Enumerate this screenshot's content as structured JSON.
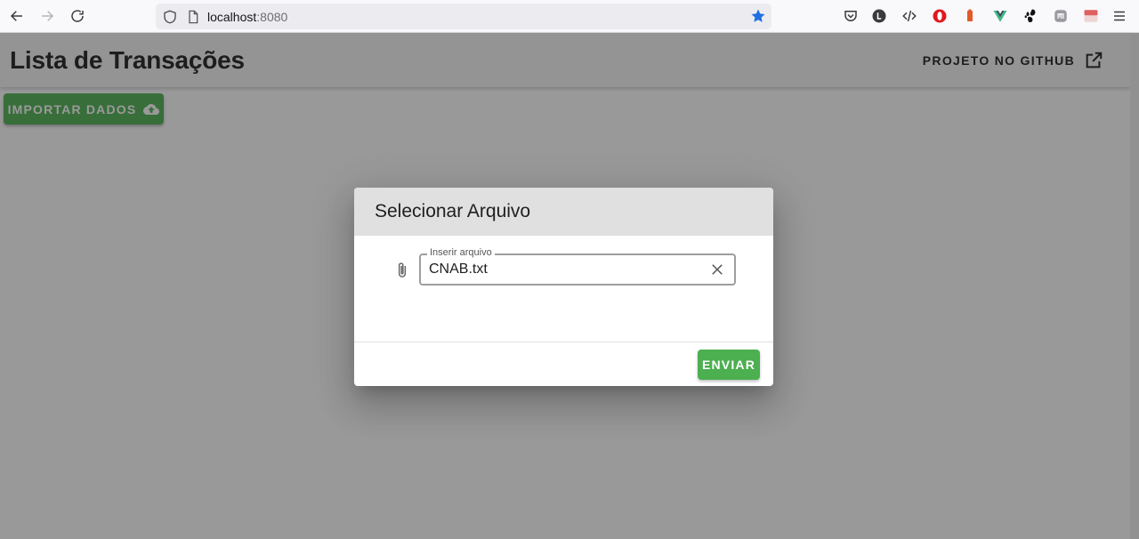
{
  "browser": {
    "url_host": "localhost",
    "url_port": ":8080",
    "extensions": [
      "pocket-icon",
      "l-extension-icon",
      "dev-tools-icon",
      "opera-icon",
      "battery-extension-icon",
      "vue-devtools-icon",
      "gnome-icon",
      "mastodon-icon",
      "cors-extension-icon",
      "menu-icon"
    ]
  },
  "app": {
    "title": "Lista de Transações",
    "github_label": "PROJETO NO GITHUB",
    "import_label": "IMPORTAR DADOS"
  },
  "dialog": {
    "title": "Selecionar Arquivo",
    "field_label": "Inserir arquivo",
    "field_value": "CNAB.txt",
    "send_label": "ENVIAR"
  },
  "colors": {
    "primary": "#4caf50",
    "star": "#1f6fe0"
  }
}
